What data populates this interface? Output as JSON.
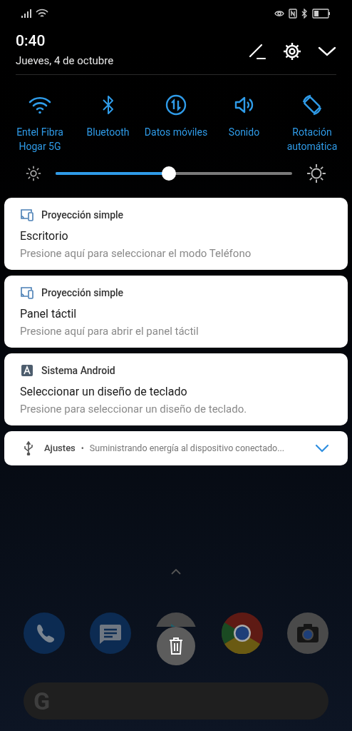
{
  "header": {
    "time": "0:40",
    "date": "Jueves, 4 de octubre"
  },
  "quick_tiles": [
    {
      "kind": "wifi",
      "label": "Entel Fibra Hogar 5G",
      "on": true
    },
    {
      "kind": "bluetooth",
      "label": "Bluetooth",
      "on": true
    },
    {
      "kind": "data",
      "label": "Datos móviles",
      "on": true
    },
    {
      "kind": "sound",
      "label": "Sonido",
      "on": true
    },
    {
      "kind": "rotation",
      "label": "Rotación automática",
      "on": true
    }
  ],
  "brightness": {
    "level": 0.48
  },
  "notifications": [
    {
      "kind": "expanded",
      "app": "Proyección simple",
      "title": "Escritorio",
      "text": "Presione aquí para seleccionar el modo Teléfono"
    },
    {
      "kind": "expanded",
      "app": "Proyección simple",
      "title": "Panel táctil",
      "text": "Presione aquí para abrir el panel táctil"
    },
    {
      "kind": "expanded",
      "app": "Sistema Android",
      "title": "Seleccionar un diseño de teclado",
      "text": "Presione para seleccionar un diseño de teclado."
    },
    {
      "kind": "collapsed",
      "app": "Ajustes",
      "separator": "•",
      "text": "Suministrando energía al dispositivo conectado..."
    }
  ],
  "search_bar": {
    "logo": "G"
  }
}
